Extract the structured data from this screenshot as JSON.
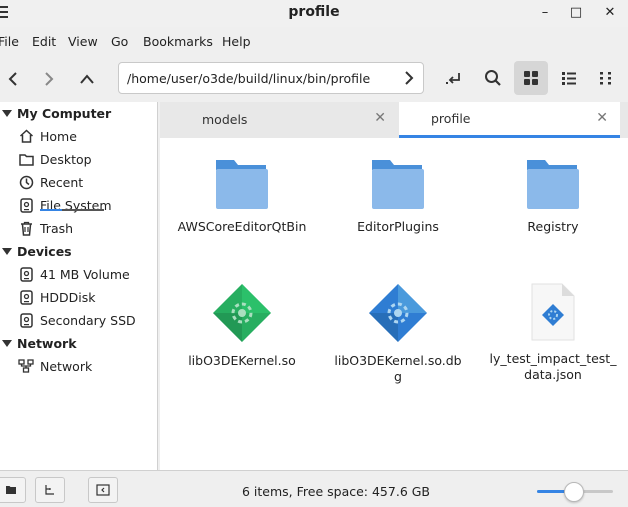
{
  "window": {
    "title": "profile",
    "minimize": "–",
    "maximize": "□",
    "close": "✕"
  },
  "menu": [
    "File",
    "Edit",
    "View",
    "Go",
    "Bookmarks",
    "Help"
  ],
  "toolbar": {
    "path": "/home/user/o3de/build/linux/bin/profile"
  },
  "sidebar": {
    "sections": [
      {
        "title": "My Computer",
        "items": [
          {
            "label": "Home",
            "icon": "home-icon"
          },
          {
            "label": "Desktop",
            "icon": "desktop-icon"
          },
          {
            "label": "Recent",
            "icon": "recent-icon"
          },
          {
            "label": "File System",
            "icon": "drive-icon"
          },
          {
            "label": "Trash",
            "icon": "trash-icon"
          }
        ]
      },
      {
        "title": "Devices",
        "items": [
          {
            "label": "41 MB Volume",
            "icon": "drive-icon"
          },
          {
            "label": "HDDDisk",
            "icon": "drive-icon"
          },
          {
            "label": "Secondary SSD",
            "icon": "drive-icon"
          }
        ]
      },
      {
        "title": "Network",
        "items": [
          {
            "label": "Network",
            "icon": "network-icon"
          }
        ]
      }
    ]
  },
  "tabs": [
    {
      "label": "models",
      "active": false
    },
    {
      "label": "profile",
      "active": true
    }
  ],
  "files": [
    {
      "name": "AWSCoreEditorQtBin",
      "type": "folder"
    },
    {
      "name": "EditorPlugins",
      "type": "folder"
    },
    {
      "name": "Registry",
      "type": "folder"
    },
    {
      "name": "libO3DEKernel.so",
      "type": "library"
    },
    {
      "name": "libO3DEKernel.so.dbg",
      "type": "debug-library"
    },
    {
      "name": "ly_test_impact_test_data.json",
      "type": "json"
    }
  ],
  "status": {
    "text": "6 items, Free space: 457.6 GB",
    "zoom_fraction": 0.49
  },
  "colors": {
    "accent": "#3584e4",
    "folder": "#7fb2e6",
    "folder_tab": "#4a90d9",
    "lib_green": "#27ae60",
    "lib_blue": "#2f7dd3"
  }
}
